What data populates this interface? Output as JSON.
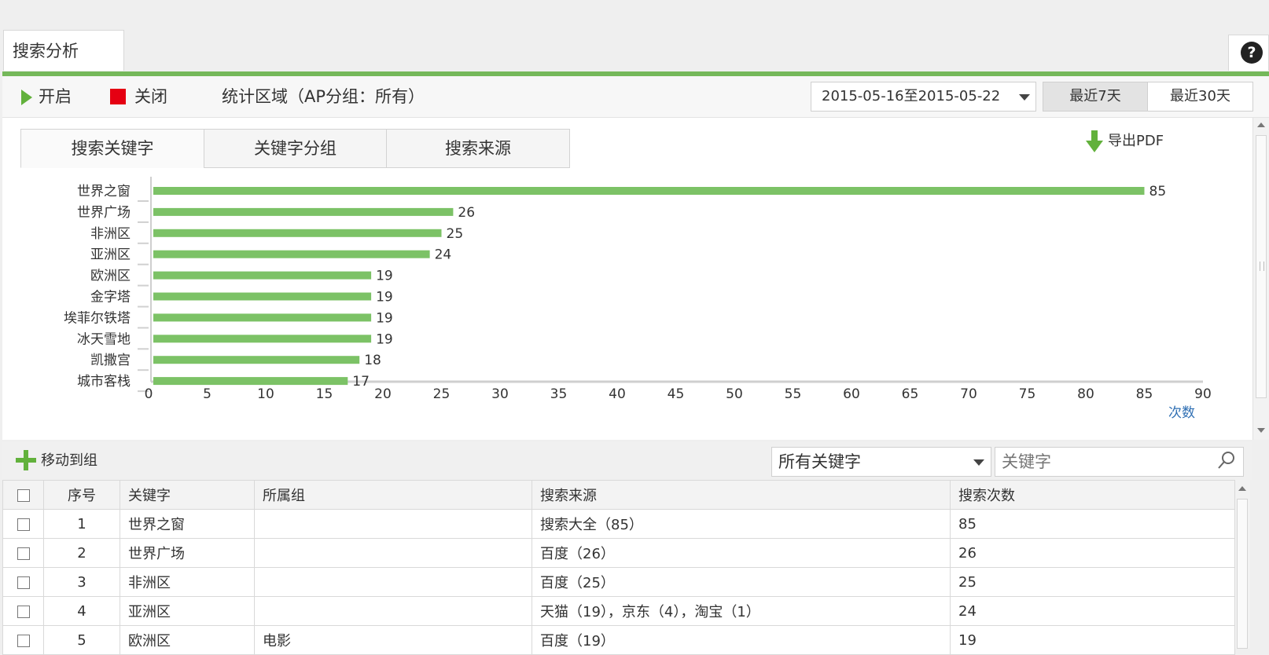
{
  "page_tab": {
    "label": "搜索分析"
  },
  "help": {
    "glyph": "?"
  },
  "toolbar": {
    "start_label": "开启",
    "stop_label": "关闭",
    "region_label": "统计区域（AP分组：所有）",
    "date_range": "2015-05-16至2015-05-22",
    "last7_label": "最近7天",
    "last30_label": "最近30天"
  },
  "chart_tabs": [
    "搜索关键字",
    "关键字分组",
    "搜索来源"
  ],
  "export_label": "导出PDF",
  "chart_data": {
    "type": "bar",
    "orientation": "horizontal",
    "categories": [
      "世界之窗",
      "世界广场",
      "非洲区",
      "亚洲区",
      "欧洲区",
      "金字塔",
      "埃菲尔铁塔",
      "冰天雪地",
      "凯撒宫",
      "城市客栈"
    ],
    "values": [
      85,
      26,
      25,
      24,
      19,
      19,
      19,
      19,
      18,
      17
    ],
    "xlim": [
      0,
      90
    ],
    "x_ticks": [
      0,
      5,
      10,
      15,
      20,
      25,
      30,
      35,
      40,
      45,
      50,
      55,
      60,
      65,
      70,
      75,
      80,
      85,
      90
    ],
    "xlabel": "次数",
    "bar_color": "#7cc266"
  },
  "bottom": {
    "move_label": "移动到组",
    "keyword_filter": "所有关键字",
    "search_placeholder": "关键字"
  },
  "table": {
    "headers": [
      "序号",
      "关键字",
      "所属组",
      "搜索来源",
      "搜索次数"
    ],
    "rows": [
      [
        "1",
        "世界之窗",
        "",
        "搜索大全（85）",
        "85"
      ],
      [
        "2",
        "世界广场",
        "",
        "百度（26）",
        "26"
      ],
      [
        "3",
        "非洲区",
        "",
        "百度（25）",
        "25"
      ],
      [
        "4",
        "亚洲区",
        "",
        "天猫（19），京东（4），淘宝（1）",
        "24"
      ],
      [
        "5",
        "欧洲区",
        "电影",
        "百度（19）",
        "19"
      ]
    ]
  },
  "colors": {
    "accent_green": "#75b85a",
    "stop_red": "#e50012",
    "axis_label_blue": "#2f6fb3"
  }
}
